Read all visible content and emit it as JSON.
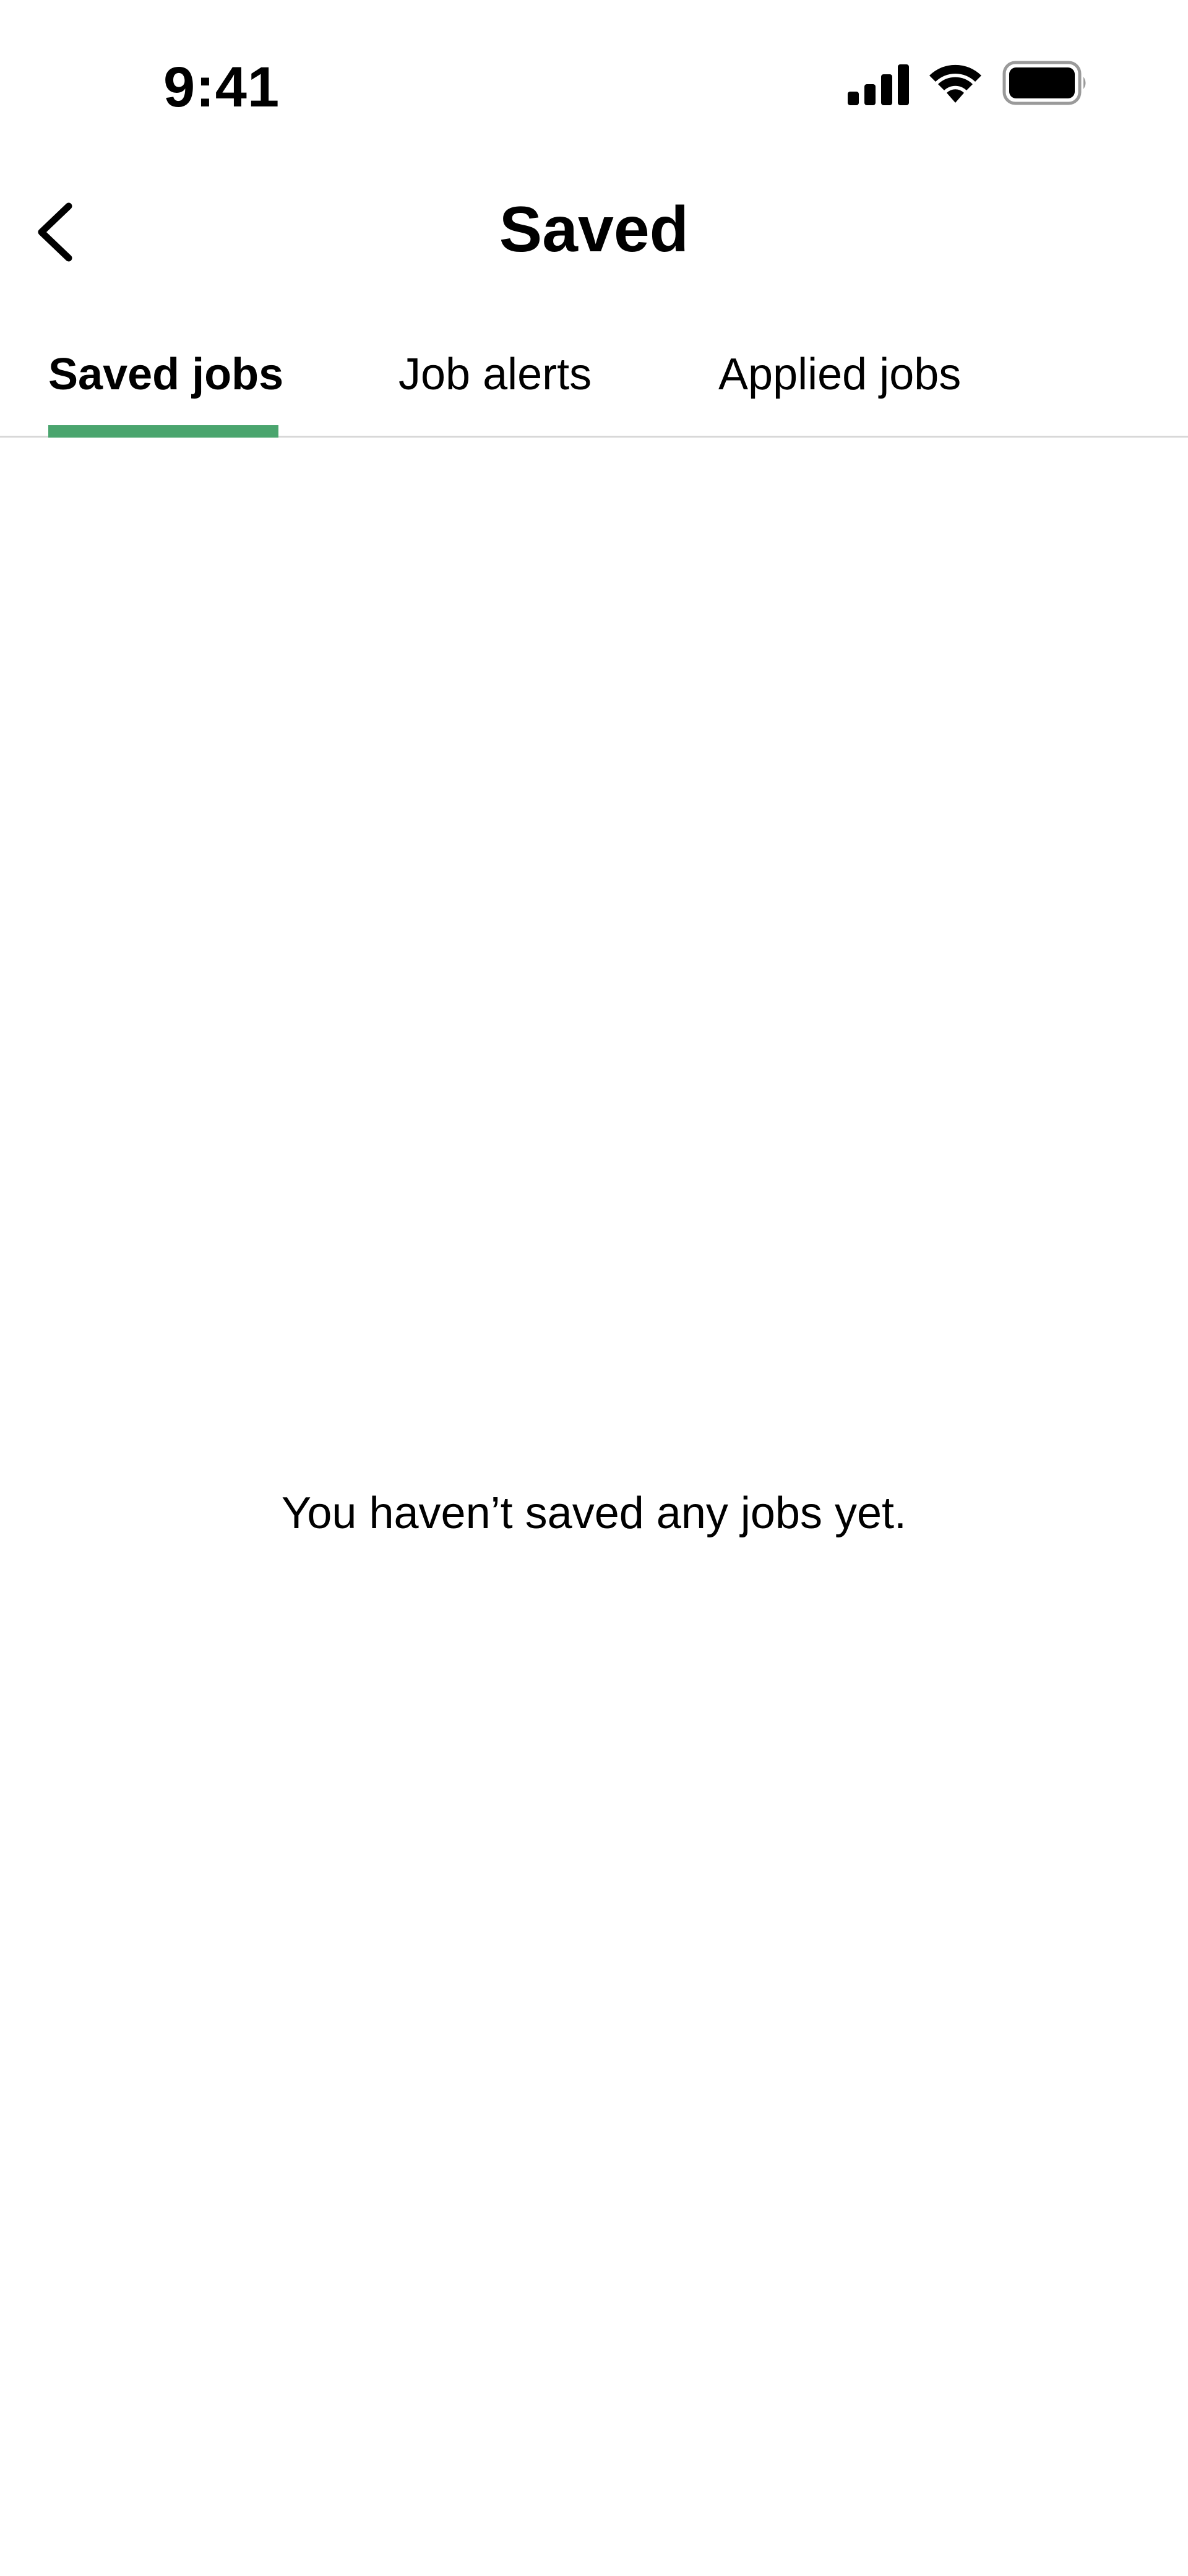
{
  "status_bar": {
    "time": "9:41",
    "icons": [
      "signal-icon",
      "wifi-icon",
      "battery-icon"
    ]
  },
  "header": {
    "title": "Saved",
    "back_icon": "chevron-left-icon"
  },
  "tabs": [
    {
      "label": "Saved jobs",
      "active": true
    },
    {
      "label": "Job alerts",
      "active": false
    },
    {
      "label": "Applied jobs",
      "active": false
    }
  ],
  "empty_state": {
    "message": "You haven’t saved any jobs yet."
  },
  "colors": {
    "accent": "#4aa56e",
    "text": "#000000",
    "divider": "#d8d8d8",
    "background": "#ffffff"
  }
}
